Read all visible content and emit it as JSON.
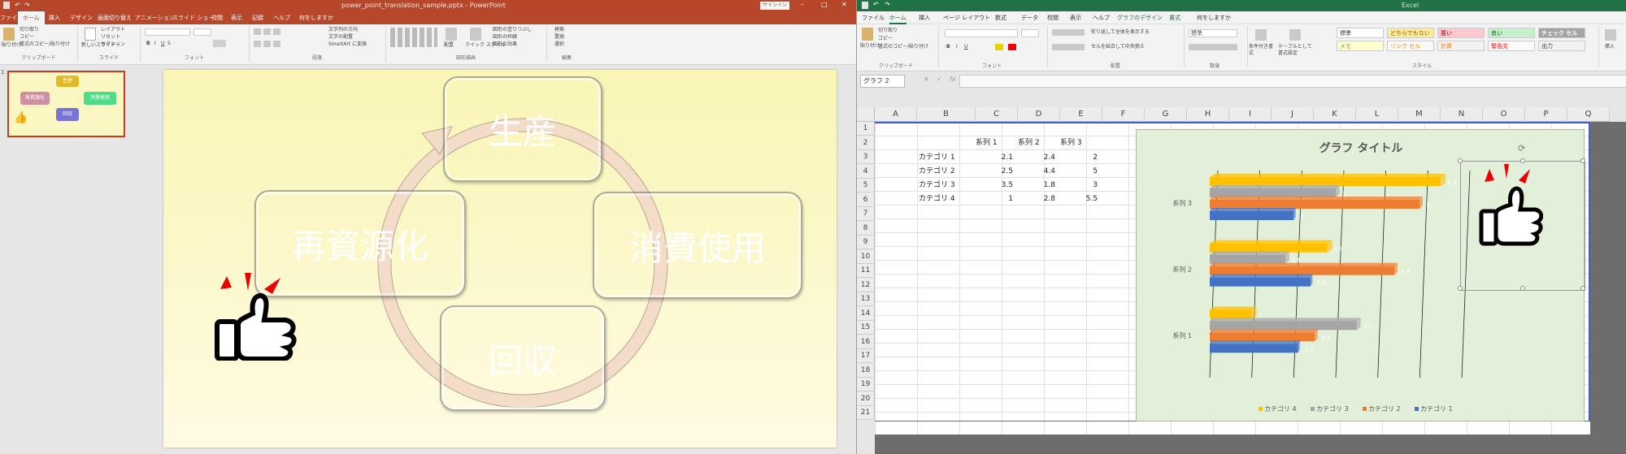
{
  "powerpoint": {
    "title": "power_point_translation_sample.pptx - PowerPoint",
    "user_badge": "サインイン",
    "tabs": [
      "ファイル",
      "ホーム",
      "挿入",
      "デザイン",
      "画面切り替え",
      "アニメーション",
      "スライド ショー",
      "校閲",
      "表示",
      "記録",
      "ヘルプ",
      "何をしますか"
    ],
    "active_tab": "ホーム",
    "ribbon": {
      "clipboard_label": "クリップボード",
      "paste": "貼り付け",
      "cut": "切り取り",
      "copy": "コピー",
      "format_painter": "書式のコピー/貼り付け",
      "slides_label": "スライド",
      "new_slide": "新しいスライド",
      "layout": "レイアウト",
      "reset": "リセット",
      "section": "セクション",
      "font_label": "フォント",
      "paragraph_label": "段落",
      "text_direction": "文字列の方向",
      "align_text": "文字の配置",
      "smartart": "SmartArt に変換",
      "drawing_label": "図形描画",
      "arrange": "配置",
      "quick_styles": "クイック スタイル",
      "shape_fill": "図形の塗りつぶし",
      "shape_outline": "図形の枠線",
      "shape_effects": "図形の効果",
      "editing_label": "編集",
      "find": "検索",
      "replace": "置換",
      "select": "選択"
    },
    "slide_number": "1",
    "thumbnail_labels": [
      "生産",
      "再資源化",
      "消費使用",
      "回収"
    ],
    "slide": {
      "boxes": [
        {
          "label": "生産",
          "color": "#e3b92c"
        },
        {
          "label": "消費使用",
          "color": "#4fdc86"
        },
        {
          "label": "回収",
          "color": "#7674d4"
        },
        {
          "label": "再資源化",
          "color": "#d08fa3"
        }
      ],
      "cycle_color": "#f3dcc8"
    }
  },
  "excel": {
    "title": "Excel",
    "tabs": [
      "ファイル",
      "ホーム",
      "挿入",
      "ページ レイアウト",
      "数式",
      "データ",
      "校閲",
      "表示",
      "ヘルプ",
      "グラフのデザイン",
      "書式",
      "何をしますか"
    ],
    "active_tab": "ホーム",
    "ribbon": {
      "paste": "貼り付け",
      "cut": "切り取り",
      "copy": "コピー",
      "format_painter": "書式のコピー/貼り付け",
      "clipboard_label": "クリップボード",
      "font_label": "フォント",
      "alignment_label": "配置",
      "wrap_text": "折り返して全体を表示する",
      "merge_center": "セルを結合して中央揃え",
      "number_label": "数値",
      "number_format": "標準",
      "conditional": "条件付き書式",
      "format_as_table": "テーブルとして書式設定",
      "styles_label": "スタイル",
      "cell_styles": [
        "標準",
        "どちらでもない",
        "悪い",
        "良い",
        "チェック セル",
        "メモ",
        "リンク セル",
        "計算",
        "警告文",
        "出力"
      ],
      "insert": "挿入"
    },
    "name_box": "グラフ 2",
    "columns": [
      "A",
      "B",
      "C",
      "D",
      "E",
      "F",
      "G",
      "H",
      "I",
      "J",
      "K",
      "L",
      "M",
      "N",
      "O",
      "P",
      "Q"
    ],
    "rows": [
      "1",
      "2",
      "3",
      "4",
      "5",
      "6",
      "7",
      "8",
      "9",
      "10",
      "11",
      "12",
      "13",
      "14",
      "15",
      "16",
      "17",
      "18",
      "19",
      "20",
      "21"
    ],
    "table": {
      "headers": [
        "系列 1",
        "系列 2",
        "系列 3"
      ],
      "rows": [
        {
          "label": "カテゴリ 1",
          "values": [
            "2.1",
            "2.4",
            "2"
          ]
        },
        {
          "label": "カテゴリ 2",
          "values": [
            "2.5",
            "4.4",
            "5"
          ]
        },
        {
          "label": "カテゴリ 3",
          "values": [
            "3.5",
            "1.8",
            "3"
          ]
        },
        {
          "label": "カテゴリ 4",
          "values": [
            "1",
            "2.8",
            "5.5"
          ]
        }
      ]
    },
    "chart_data": {
      "type": "bar",
      "title": "グラフ タイトル",
      "categories": [
        "系列 1",
        "系列 2",
        "系列 3"
      ],
      "series": [
        {
          "name": "カテゴリ 4",
          "values": [
            1,
            2.8,
            5.5
          ],
          "color": "#ffc000"
        },
        {
          "name": "カテゴリ 3",
          "values": [
            3.5,
            1.8,
            3
          ],
          "color": "#a5a5a5"
        },
        {
          "name": "カテゴリ 2",
          "values": [
            2.5,
            4.4,
            5
          ],
          "color": "#ed7d31"
        },
        {
          "name": "カテゴリ 1",
          "values": [
            2.1,
            2.4,
            2
          ],
          "color": "#4472c4"
        }
      ],
      "xlim": [
        0,
        6
      ],
      "legend": "bottom",
      "grid": true
    }
  }
}
